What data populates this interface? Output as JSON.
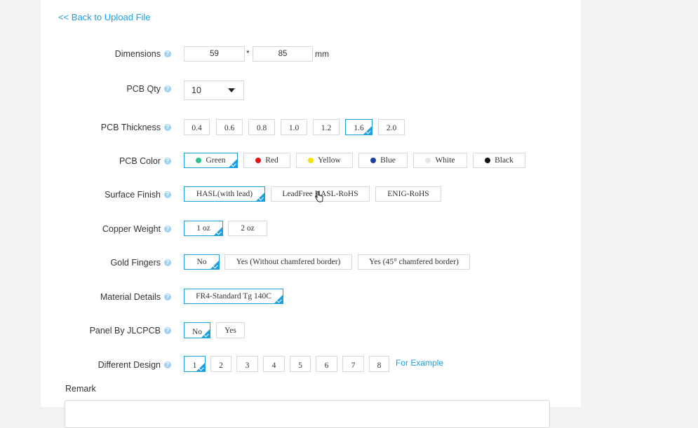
{
  "back_link": "<< Back to Upload File",
  "dimensions": {
    "label": "Dimensions",
    "width": "59",
    "separator": "*",
    "height": "85",
    "unit": "mm"
  },
  "qty": {
    "label": "PCB Qty",
    "value": "10"
  },
  "thickness": {
    "label": "PCB Thickness",
    "options": [
      "0.4",
      "0.6",
      "0.8",
      "1.0",
      "1.2",
      "1.6",
      "2.0"
    ],
    "selected": "1.6"
  },
  "color": {
    "label": "PCB Color",
    "options": [
      {
        "name": "Green",
        "dot": "#2bc48a"
      },
      {
        "name": "Red",
        "dot": "#e8131a"
      },
      {
        "name": "Yellow",
        "dot": "#f4e200"
      },
      {
        "name": "Blue",
        "dot": "#1e3f9e"
      },
      {
        "name": "White",
        "dot": "#e6e6e6"
      },
      {
        "name": "Black",
        "dot": "#111111"
      }
    ],
    "selected": "Green"
  },
  "surface": {
    "label": "Surface Finish",
    "options": [
      "HASL(with lead)",
      "LeadFree HASL-RoHS",
      "ENIG-RoHS"
    ],
    "selected": "HASL(with lead)"
  },
  "copper": {
    "label": "Copper Weight",
    "options": [
      "1 oz",
      "2 oz"
    ],
    "selected": "1 oz"
  },
  "gold": {
    "label": "Gold Fingers",
    "options": [
      "No",
      "Yes (Without chamfered border)",
      "Yes (45° chamfered border)"
    ],
    "selected": "No"
  },
  "material": {
    "label": "Material Details",
    "options": [
      "FR4-Standard Tg 140C"
    ],
    "selected": "FR4-Standard Tg 140C"
  },
  "panel": {
    "label": "Panel By JLCPCB",
    "options": [
      "No",
      "Yes"
    ],
    "selected": "No"
  },
  "design": {
    "label": "Different Design",
    "options": [
      "1",
      "2",
      "3",
      "4",
      "5",
      "6",
      "7",
      "8"
    ],
    "selected": "1",
    "example": "For Example"
  },
  "remark": {
    "label": "Remark"
  },
  "help_glyph": "?",
  "accent": "#1a9fe0"
}
